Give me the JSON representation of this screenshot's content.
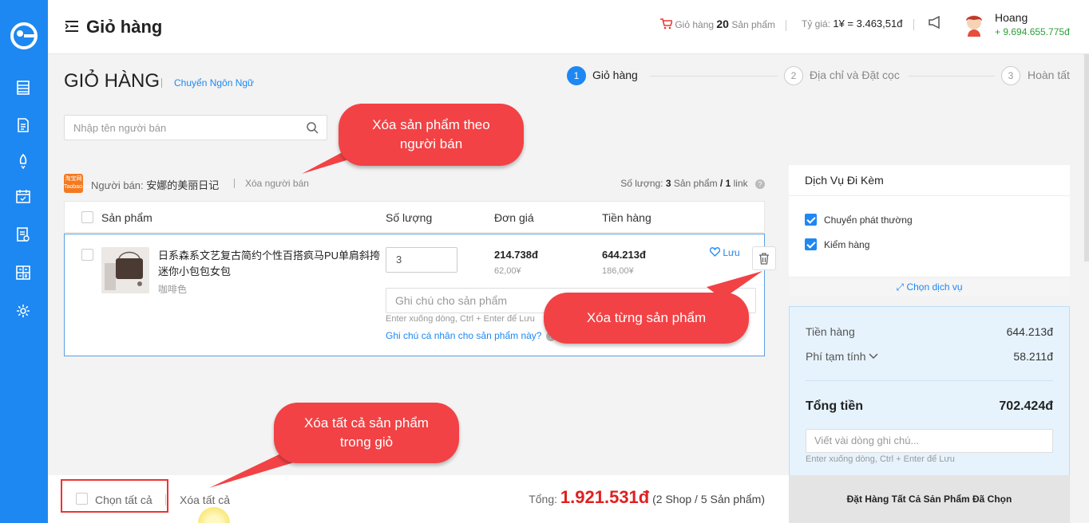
{
  "app": {
    "title": "Giỏ hàng"
  },
  "header": {
    "cart_label": "Giỏ hàng",
    "cart_count": "20",
    "cart_unit": "Sản phẩm",
    "rate_label": "Tỷ giá:",
    "rate_value": "1¥ = 3.463,51đ",
    "user_name": "Hoang",
    "user_balance": "+ 9.694.655.775đ"
  },
  "sidebar": {
    "icons": [
      "logo-icon",
      "orders-icon",
      "document-icon",
      "rocket-icon",
      "calendar-icon",
      "report-icon",
      "calculator-icon",
      "gear-icon"
    ]
  },
  "page": {
    "title": "GIỎ HÀNG",
    "lang_link": "Chuyển Ngôn Ngữ"
  },
  "steps": [
    {
      "num": "1",
      "label": "Giỏ hàng",
      "active": true
    },
    {
      "num": "2",
      "label": "Địa chỉ và Đặt cọc",
      "active": false
    },
    {
      "num": "3",
      "label": "Hoàn tất",
      "active": false
    }
  ],
  "search": {
    "placeholder": "Nhập tên người bán"
  },
  "callouts": {
    "seller": "Xóa sản phẩm theo người bán",
    "item": "Xóa từng sản phẩm",
    "all": "Xóa tất cả sản phẩm trong giỏ"
  },
  "seller": {
    "logo_text": "淘宝网 Taobao.com",
    "label": "Người bán:",
    "name": "安娜的美丽日记",
    "delete": "Xóa người bán",
    "qty_label": "Số lượng:",
    "qty_count": "3",
    "qty_unit": "Sản phẩm",
    "links_count": "1",
    "links_unit": "link"
  },
  "table": {
    "columns": [
      "Sản phẩm",
      "Số lượng",
      "Đơn giá",
      "Tiền hàng"
    ]
  },
  "item": {
    "name": "日系森系文艺复古简约个性百搭疯马PU单肩斜挎迷你小包包女包",
    "variant": "咖啡色",
    "qty": "3",
    "unit_price": "214.738đ",
    "unit_price_cny": "62,00¥",
    "line_total": "644.213đ",
    "line_total_cny": "186,00¥",
    "save_label": "Lưu",
    "note_placeholder": "Ghi chú cho sản phẩm",
    "note_hint": "Enter xuống dòng, Ctrl + Enter để Lưu",
    "note_link": "Ghi chú cá nhân cho sản phẩm này?"
  },
  "services": {
    "title": "Dịch Vụ Đi Kèm",
    "items": [
      {
        "label": "Chuyển phát thường",
        "checked": true
      },
      {
        "label": "Kiểm hàng",
        "checked": true
      }
    ],
    "choose": "Chọn dịch vụ"
  },
  "summary": {
    "subtotal_label": "Tiền hàng",
    "subtotal": "644.213đ",
    "fee_label": "Phí tạm tính",
    "fee": "58.211đ",
    "total_label": "Tổng tiền",
    "total": "702.424đ",
    "note_placeholder": "Viết vài dòng ghi chú...",
    "note_hint": "Enter xuống dòng, Ctrl + Enter để Lưu"
  },
  "bottom": {
    "select_all": "Chọn tất cả",
    "delete_all": "Xóa tất cả",
    "grand_label": "Tổng:",
    "grand_total": "1.921.531đ",
    "grand_detail": "(2 Shop / 5 Sản phẩm)",
    "order_button": "Đặt Hàng Tất Cả Sản Phẩm Đã Chọn"
  },
  "colors": {
    "primary": "#1e88f2",
    "callout": "#f24245",
    "price_red": "#e02020",
    "balance_green": "#2e9e3a"
  }
}
